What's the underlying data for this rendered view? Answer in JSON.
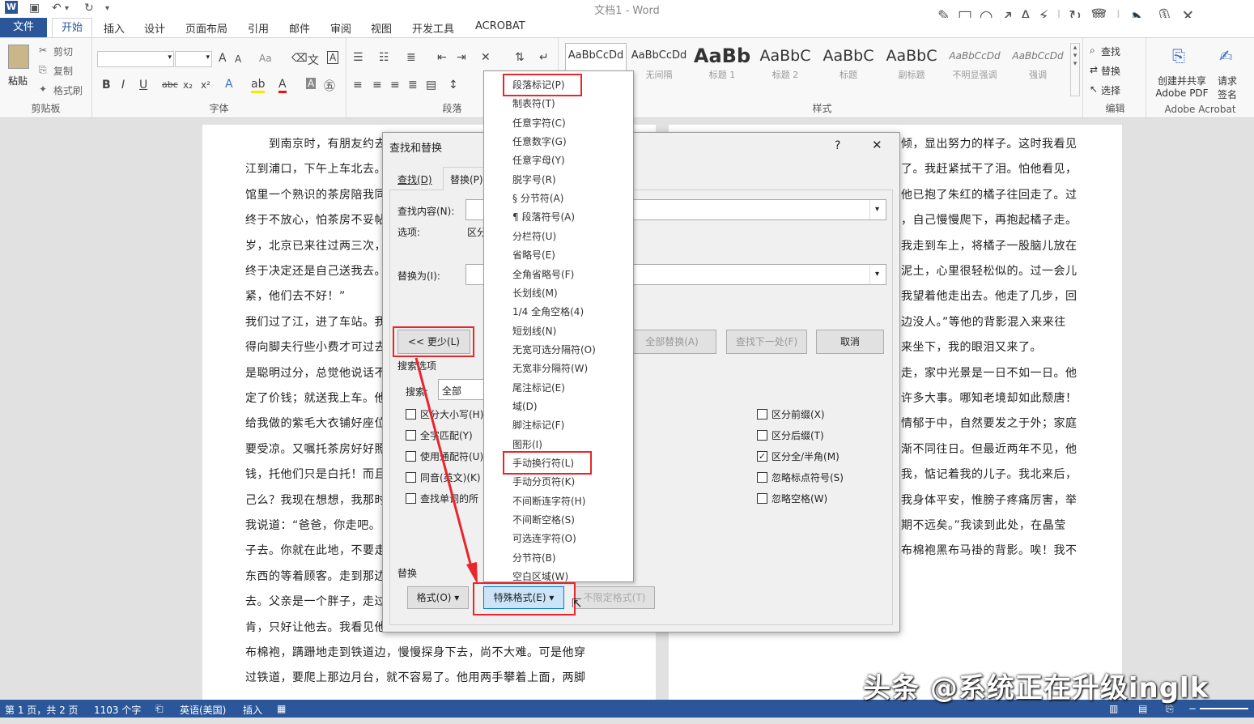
{
  "window": {
    "title": "文档1 - Word"
  },
  "tabs": [
    "文件",
    "开始",
    "插入",
    "设计",
    "页面布局",
    "引用",
    "邮件",
    "审阅",
    "视图",
    "开发工具",
    "ACROBAT"
  ],
  "clipboard": {
    "paste": "粘贴",
    "cut": "剪切",
    "copy": "复制",
    "format_painter": "格式刷",
    "label": "剪贴板"
  },
  "font_group": {
    "label": "字体",
    "change_case": "Aa"
  },
  "paragraph_group": {
    "label": "段落"
  },
  "styles": {
    "label": "样式",
    "items": [
      {
        "sample": "AaBbCcDd",
        "name": ""
      },
      {
        "sample": "AaBbCcDd",
        "name": "无间隔"
      },
      {
        "sample": "AaBb",
        "name": "标题 1"
      },
      {
        "sample": "AaBbC",
        "name": "标题 2"
      },
      {
        "sample": "AaBbC",
        "name": "标题"
      },
      {
        "sample": "AaBbC",
        "name": "副标题"
      },
      {
        "sample": "AaBbCcDd",
        "name": "不明显强调"
      },
      {
        "sample": "AaBbCcDd",
        "name": "强调"
      }
    ]
  },
  "editing": {
    "label": "编辑",
    "find": "查找",
    "replace": "替换",
    "select": "选择"
  },
  "acrobat": {
    "label": "Adobe Acrobat",
    "create": "创建并共享\nAdobe PDF",
    "request": "请求\n签名"
  },
  "doc_left": [
    "到南京时，有朋友约去",
    "江到浦口，下午上车北去。",
    "馆里一个熟识的茶房陪我同",
    "终于不放心，怕茶房不妥帖",
    "岁，北京已来往过两三次，",
    "终于决定还是自己送我去。",
    "紧，他们去不好！”",
    "我们过了江，进了车站。我",
    "得向脚夫行些小费才可过去",
    "是聪明过分，总觉他说话不",
    "定了价钱；就送我上车。他",
    "给我做的紫毛大衣铺好座位",
    "要受凉。又嘱托茶房好好照",
    "钱，托他们只是白托！而且",
    "己么？我现在想想，我那时",
    "我说道：“爸爸，你走吧。",
    "子去。你就在此地，不要走",
    "东西的等着顾客。走到那边",
    "去。父亲是一个胖子，走过",
    "肯，只好让他去。我看见他",
    "布棉袍，蹒跚地走到铁道边，慢慢探身下去，尚不大难。可是他穿",
    "过铁道，要爬上那边月台，就不容易了。他用两手攀着上面，两脚"
  ],
  "doc_right": [
    "倾，显出努力的样子。这时我看见",
    "了。我赶紧拭干了泪。怕他看见，",
    "他已抱了朱红的橘子往回走了。过",
    "，自己慢慢爬下，再抱起橘子走。",
    "我走到车上，将橘子一股脑儿放在",
    "泥土，心里很轻松似的。过一会儿",
    "我望着他走出去。他走了几步，回",
    "边没人。”等他的背影混入来来往",
    "来坐下，我的眼泪又来了。",
    "走，家中光景是一日不如一日。他",
    "许多大事。哪知老境却如此颓唐！",
    "情郁于中，自然要发之于外；家庭",
    "渐不同往日。但最近两年不见，他",
    "我，惦记着我的儿子。我北来后，",
    "我身体平安，惟膀子疼痛厉害，举",
    "期不远矣。”我读到此处，在晶莹",
    "布棉袍黑布马褂的背影。唉！我不"
  ],
  "dialog": {
    "title": "查找和替换",
    "help": "?",
    "close": "✕",
    "tab_find": "查找(D)",
    "tab_replace": "替换(P)",
    "find_label": "查找内容(N):",
    "options_label": "选项:",
    "options_value": "区分",
    "replace_label": "替换为(I):",
    "less_button": "<< 更少(L)",
    "replace_all": "全部替换(A)",
    "find_next": "查找下一处(F)",
    "cancel": "取消",
    "search_options": "搜索选项",
    "search_label": "搜索:",
    "search_value": "全部",
    "checks_left": [
      {
        "label": "区分大小写(H)",
        "checked": false
      },
      {
        "label": "全字匹配(Y)",
        "checked": false
      },
      {
        "label": "使用通配符(U)",
        "checked": false
      },
      {
        "label": "同音(英文)(K)",
        "checked": false
      },
      {
        "label": "查找单词的所",
        "checked": false
      }
    ],
    "checks_right": [
      {
        "label": "区分前缀(X)",
        "checked": false
      },
      {
        "label": "区分后缀(T)",
        "checked": false
      },
      {
        "label": "区分全/半角(M)",
        "checked": true
      },
      {
        "label": "忽略标点符号(S)",
        "checked": false
      },
      {
        "label": "忽略空格(W)",
        "checked": false
      }
    ],
    "replace_section": "替换",
    "format_button": "格式(O)",
    "special_button": "特殊格式(E)",
    "no_format": "不限定格式(T)"
  },
  "special_menu": [
    "段落标记(P)",
    "制表符(T)",
    "任意字符(C)",
    "任意数字(G)",
    "任意字母(Y)",
    "脱字号(R)",
    "§ 分节符(A)",
    "¶ 段落符号(A)",
    "分栏符(U)",
    "省略号(E)",
    "全角省略号(F)",
    "长划线(M)",
    "1/4 全角空格(4)",
    "短划线(N)",
    "无宽可选分隔符(O)",
    "无宽非分隔符(W)",
    "尾注标记(E)",
    "域(D)",
    "脚注标记(F)",
    "图形(I)",
    "手动换行符(L)",
    "手动分页符(K)",
    "不间断连字符(H)",
    "不间断空格(S)",
    "可选连字符(O)",
    "分节符(B)",
    "空白区域(W)"
  ],
  "status": {
    "page": "第 1 页，共 2 页",
    "words": "1103 个字",
    "lang": "英语(美国)",
    "mode": "插入"
  },
  "watermark": "头条 @系统正在升级inglk",
  "colors": {
    "accent": "#2b579a",
    "highlight": "#e8262b"
  }
}
